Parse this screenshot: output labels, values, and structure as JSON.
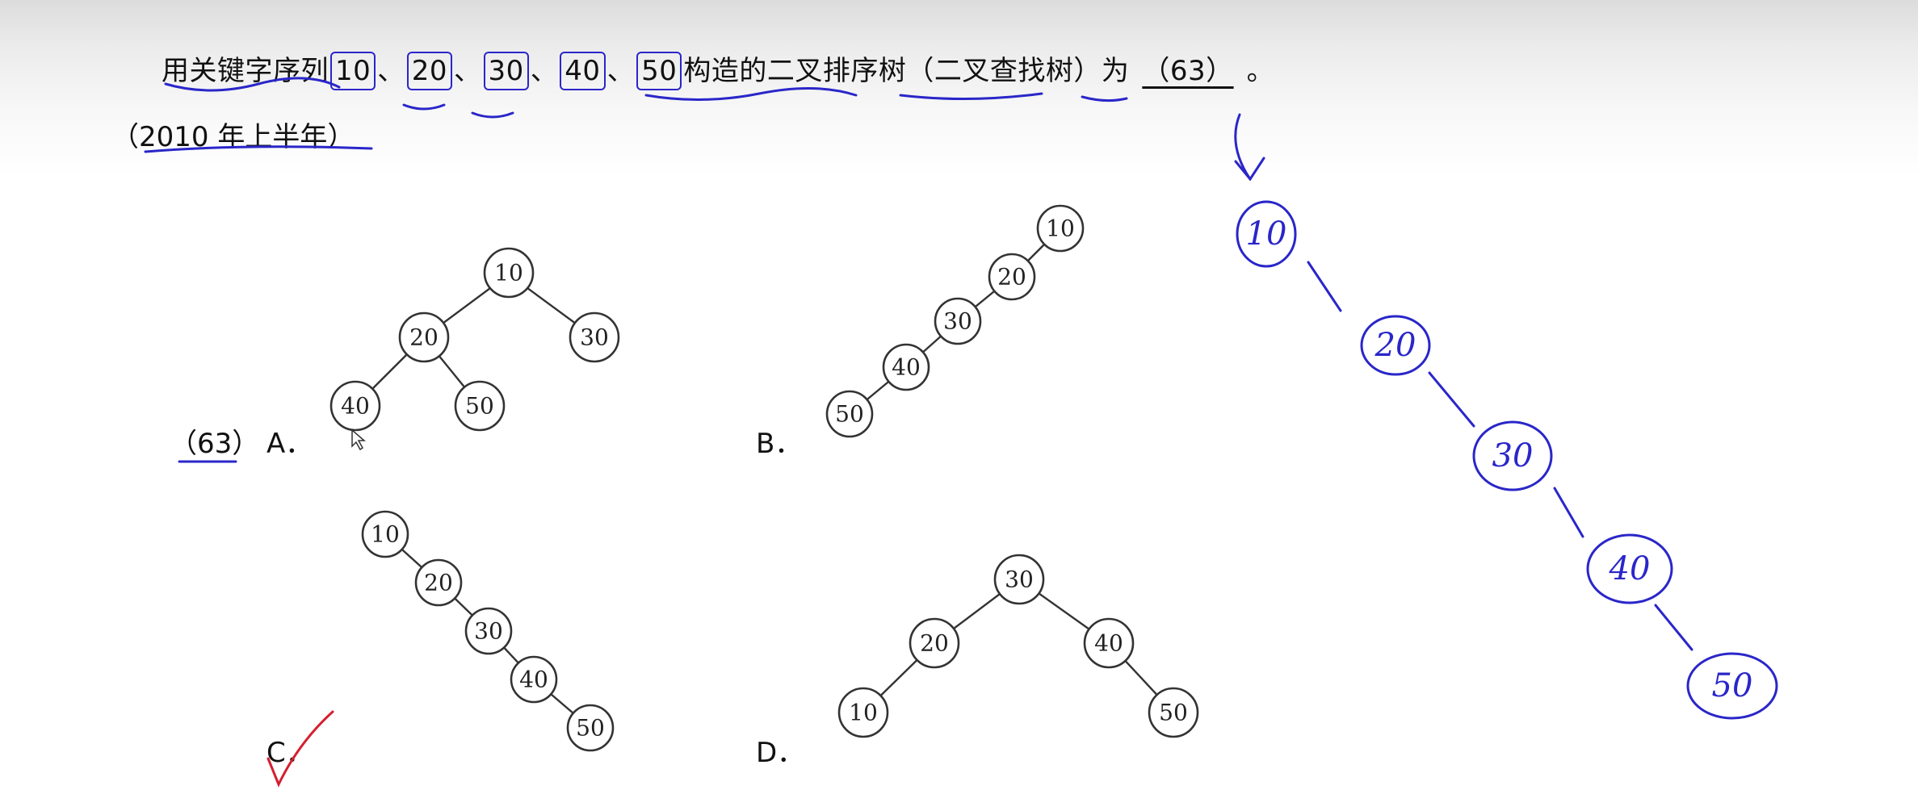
{
  "question": {
    "prefix": "用关键字序列",
    "keys": [
      "10",
      "20",
      "30",
      "40",
      "50"
    ],
    "separator": "、",
    "suffix": "构造的二叉排序树（二叉查找树）为",
    "blank": "（63）",
    "end": "。",
    "year": "（2010 年上半年）"
  },
  "answer_number": "（63）",
  "options": [
    {
      "label": "A．",
      "tree": "balanced: 10 root; left 20 (children 40, 50); right 30"
    },
    {
      "label": "B．",
      "tree": "chain 10-20-30-40-50 leaning left"
    },
    {
      "label": "C．",
      "tree": "chain 10-20-30-40-50 leaning right"
    },
    {
      "label": "D．",
      "tree": "30 root; left 20 (child 10); right 40 (child 50)"
    }
  ],
  "annotation": {
    "handwritten_nodes": [
      "10",
      "20",
      "30",
      "40",
      "50"
    ],
    "checkmark_on": "C",
    "ink_colors": {
      "blue": "#2a26c9",
      "red": "#d42030"
    }
  }
}
